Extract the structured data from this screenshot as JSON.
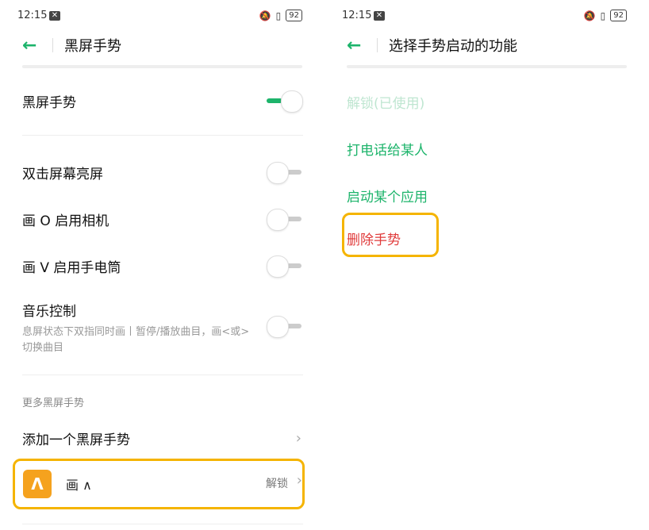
{
  "left": {
    "status": {
      "time": "12:15",
      "battery": "92"
    },
    "title": "黑屏手势",
    "rows": [
      {
        "label": "黑屏手势"
      },
      {
        "label": "双击屏幕亮屏"
      },
      {
        "label": "画 O 启用相机"
      },
      {
        "label": "画 V 启用手电筒"
      },
      {
        "label": "音乐控制",
        "sub": "息屏状态下双指同时画丨暂停/播放曲目，画<或>切换曲目"
      }
    ],
    "toggles": [
      "on",
      "off",
      "off",
      "off",
      "off"
    ],
    "section_title": "更多黑屏手势",
    "add_label": "添加一个黑屏手势",
    "gesture_item": {
      "icon_glyph": "Λ",
      "label": "画 ∧",
      "value": "解锁"
    }
  },
  "right": {
    "status": {
      "time": "12:15",
      "battery": "92"
    },
    "title": "选择手势启动的功能",
    "options": [
      {
        "label": "解锁(已使用)"
      },
      {
        "label": "打电话给某人"
      },
      {
        "label": "启动某个应用"
      },
      {
        "label": "删除手势"
      }
    ]
  },
  "colors": {
    "accent": "#1db46b",
    "highlight": "#f5b400",
    "danger": "#e03b3b",
    "icon_bg": "#f5a21e"
  }
}
